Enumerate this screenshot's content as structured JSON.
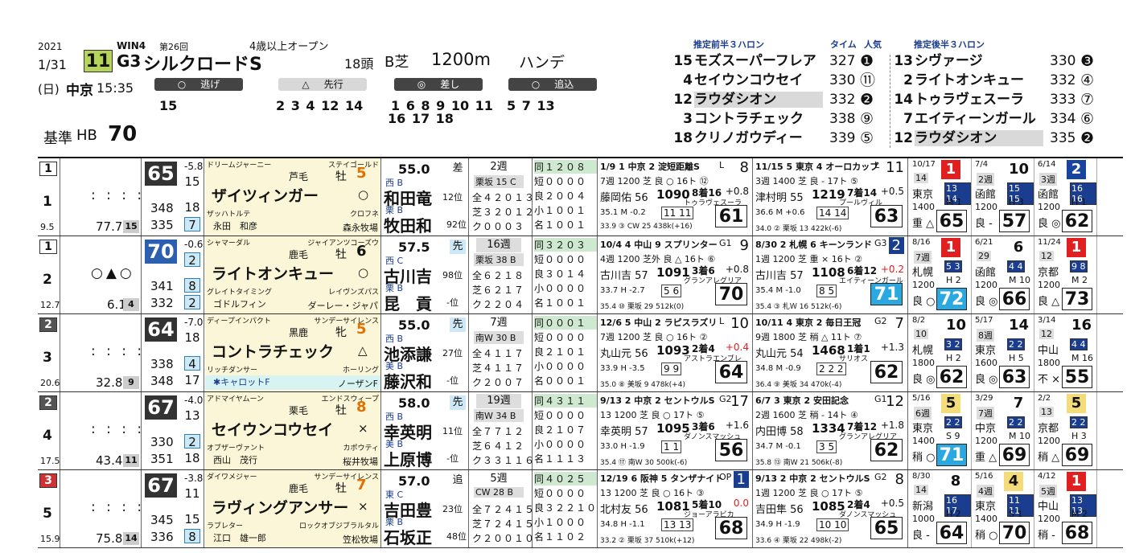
{
  "race": {
    "year": "2021",
    "date": "1/31",
    "day": "(日)",
    "venue": "中京",
    "time": "15:35",
    "win": "WIN4",
    "kai": "第26回",
    "race_no": "11",
    "grade": "G3",
    "name": "シルクロードS",
    "condition": "4歳以上オープン",
    "field": "18頭",
    "course": "B芝",
    "distance": "1200m",
    "handicap": "ハンデ",
    "baseline_label": "基準",
    "baseline_code": "HB",
    "baseline_value": "70"
  },
  "styles": {
    "nige": {
      "label": "逃げ",
      "horses": "15"
    },
    "senko": {
      "label": "先行",
      "horses": "2  3  4 12 14"
    },
    "sashi": {
      "label": "差し",
      "horses_line1": "1  6  8  9 10 11",
      "horses_line2": "16 17 18"
    },
    "oikomi": {
      "label": "追込",
      "horses": "5  7 13"
    }
  },
  "pace": {
    "front_title": "推定前半３ハロン",
    "back_title": "推定後半３ハロン",
    "time_label": "タイム",
    "pop_label": "人気",
    "front": [
      {
        "no": "15",
        "name": "モズスーパーフレア",
        "time": "327",
        "pop": "1",
        "hl": false
      },
      {
        "no": " 4",
        "name": "セイウンコウセイ",
        "time": "330",
        "pop": "11",
        "hl": false
      },
      {
        "no": "12",
        "name": "ラウダシオン",
        "time": "332",
        "pop": "2",
        "hl": true
      },
      {
        "no": " 3",
        "name": "コントラチェック",
        "time": "338",
        "pop": "9",
        "hl": false
      },
      {
        "no": "18",
        "name": "クリノガウディー",
        "time": "339",
        "pop": "5",
        "hl": false
      }
    ],
    "back": [
      {
        "no": "13",
        "name": "シヴァージ",
        "time": "330",
        "pop": "3",
        "hl": false
      },
      {
        "no": " 2",
        "name": "ライトオンキュー",
        "time": "332",
        "pop": "4",
        "hl": false
      },
      {
        "no": "14",
        "name": "トゥラヴェスーラ",
        "time": "333",
        "pop": "7",
        "hl": false
      },
      {
        "no": " 7",
        "name": "エイティーンガール",
        "time": "334",
        "pop": "6",
        "hl": false
      },
      {
        "no": "12",
        "name": "ラウダシオン",
        "time": "335",
        "pop": "2",
        "hl": true
      }
    ]
  },
  "horses": [
    {
      "waku": "1",
      "umaban": "1",
      "odds": "9.5",
      "marks": ": : : :",
      "ev": "77.7",
      "evrank": "15",
      "idx": "65",
      "idx_diff": "-5.8",
      "idx_rank": "15",
      "sub1": "348",
      "sub1r": "18",
      "sub2": "335",
      "sub2r": "7",
      "sire": "ドリームジャーニー",
      "bms": "ステイゴールド",
      "color": "芦毛",
      "sex": "牡",
      "age": "5",
      "name": "ザイツィンガー",
      "mark": "○",
      "dam": "ザッハトルテ",
      "damsire": "クロフネ",
      "owner": "永田　和彦",
      "breeder": "森永牧場",
      "weight": "55.0",
      "region": "西",
      "jockey": "和田竜",
      "jmark": "B",
      "trainer": "牧田和",
      "tmark": "栗",
      "jrank": "12位",
      "trank": "92位",
      "style": "差",
      "interval": "2週",
      "cond": "栗坂 15 C",
      "rec1": "全４２０１３",
      "rec2": "芝３２０１２",
      "rec3": "ク０００３",
      "dist1": "同１２０８",
      "dist2": "短００００",
      "dist3": "良２００４",
      "dist4": "小１００１",
      "dist5": "名１００１"
    },
    {
      "waku": "1",
      "umaban": "2",
      "odds": "12.7",
      "marks": "○▲○",
      "ev": "6.1",
      "evrank": "4",
      "idx": "70",
      "idx_diff": "-0.6",
      "idx_rank": "2",
      "sub1": "341",
      "sub1r": "8",
      "sub2": "332",
      "sub2r": "2",
      "sire": "シャマーダル",
      "bms": "ジャイアンツコーズウ",
      "color": "鹿毛",
      "sex": "牡",
      "age": "6",
      "name": "ライトオンキュー",
      "mark": "○",
      "dam": "グレイトタイミング",
      "damsire": "レイヴンズパス",
      "owner": "ゴドルフィン",
      "breeder": "ダーレー・ジャパ",
      "weight": "57.5",
      "region": "西",
      "jockey": "古川吉",
      "jmark": "C",
      "trainer": "昆　貢",
      "tmark": "栗",
      "jrank": "98位",
      "trank": "-位",
      "style": "先",
      "interval": "16週",
      "cond": "栗坂 38 B",
      "rec1": "全６２１８",
      "rec2": "芝６２１７",
      "rec3": "ク２２０４",
      "dist1": "同３２０３",
      "dist2": "短００００",
      "dist3": "良３０１４",
      "dist4": "小００００",
      "dist5": "名１００１"
    },
    {
      "waku": "2",
      "umaban": "3",
      "odds": "20.6",
      "marks": ": : : :",
      "ev": "32.8",
      "evrank": "9",
      "idx": "64",
      "idx_diff": "-7.0",
      "idx_rank": "18",
      "sub1": "338",
      "sub1r": "4",
      "sub2": "348",
      "sub2r": "17",
      "sire": "ディープインパクト",
      "bms": "サンデーサイレンス",
      "color": "黒鹿",
      "sex": "牝",
      "age": "5",
      "name": "コントラチェック",
      "mark": "△",
      "dam": "リッチダンサー",
      "damsire": "ホーリング",
      "owner": "✱キャロットF",
      "breeder": "ノーザンF",
      "weight": "55.0",
      "region": "西",
      "jockey": "池添謙",
      "jmark": "B",
      "trainer": "藤沢和",
      "tmark": "美",
      "jrank": "27位",
      "trank": "-位",
      "style": "先",
      "interval": "7週",
      "cond": "南W 30 B",
      "rec1": "全４１１７",
      "rec2": "芝４１１７",
      "rec3": "ク２００７",
      "dist1": "同０００１",
      "dist2": "短００００",
      "dist3": "良２１０１",
      "dist4": "小００００",
      "dist5": "名０００１"
    },
    {
      "waku": "2",
      "umaban": "4",
      "odds": "17.5",
      "marks": ": : : :",
      "ev": "43.4",
      "evrank": "11",
      "idx": "67",
      "idx_diff": "-4.0",
      "idx_rank": "13",
      "sub1": "330",
      "sub1r": "2",
      "sub2": "351",
      "sub2r": "18",
      "sire": "アドマイヤムーン",
      "bms": "エンドスウィープ",
      "color": "栗毛",
      "sex": "牡",
      "age": "8",
      "name": "セイウンコウセイ",
      "mark": "×",
      "dam": "オブザーヴァント",
      "damsire": "カポウティ",
      "owner": "西山　茂行",
      "breeder": "桜井牧場",
      "weight": "58.0",
      "region": "西",
      "jockey": "幸英明",
      "jmark": "B",
      "trainer": "上原博",
      "tmark": "美",
      "jrank": "11位",
      "trank": "-位",
      "style": "先",
      "interval": "19週",
      "cond": "南W 34 B",
      "rec1": "全７７１２",
      "rec2": "芝６４１２",
      "rec3": "ク３３１１６",
      "dist1": "同４３１１",
      "dist2": "短００００",
      "dist3": "良２１０７",
      "dist4": "小００００",
      "dist5": "名１１１３"
    },
    {
      "waku": "3",
      "umaban": "5",
      "odds": "15.9",
      "marks": ": : : :",
      "ev": "75.8",
      "evrank": "14",
      "idx": "67",
      "idx_diff": "-3.8",
      "idx_rank": "11",
      "sub1": "345",
      "sub1r": "15",
      "sub2": "336",
      "sub2r": "8",
      "sire": "ダイワメジャー",
      "bms": "サンデーサイレンス",
      "color": "鹿毛",
      "sex": "牡",
      "age": "7",
      "name": "ラヴィングアンサー",
      "mark": "×",
      "dam": "ラブレター",
      "damsire": "ロックオブジブラルタル",
      "owner": "江口　雄一郎",
      "breeder": "笠松牧場",
      "weight": "57.0",
      "region": "東",
      "jockey": "吉田豊",
      "jmark": "C",
      "trainer": "石坂正",
      "tmark": "栗",
      "jrank": "23位",
      "trank": "48位",
      "style": "追",
      "interval": "5週",
      "cond": "CW 28 B",
      "rec1": "全７２４１５",
      "rec2": "芝７２４１５",
      "rec3": "ク２００１０",
      "dist1": "同４０２５",
      "dist2": "短００００",
      "dist3": "良３２２１０",
      "dist4": "小１０００",
      "dist5": "名１１０２"
    }
  ],
  "races": [
    [
      {
        "date": "1/9",
        "grade": "1",
        "venue": "中京",
        "cls": "2 淀短距離S",
        "gl": "L",
        "pos": "8",
        "meta": "7週 1200 芝 良 ○ 16ト ⑫",
        "jockey": "藤岡佑",
        "wt": "56",
        "time": "1090",
        "margin": "8着16",
        "diff": "+0.8",
        "winner": "トゥラヴェスーラ",
        "score": "61",
        "c1": "11 11",
        "sub": "35.1 M -0.2",
        "tr": "33.9 ③ CW 25 438k(+16)"
      },
      {
        "date": "11/15",
        "grade": "5",
        "venue": "東京",
        "cls": "4 オーロカップ",
        "gl": "L",
        "pos": "11",
        "meta": "3週 1400 芝 良 - 17ト ⑤",
        "jockey": "津村明",
        "wt": "55",
        "time": "1219",
        "margin": "7着14",
        "diff": "+0.5",
        "winner": "プールヴィル",
        "score": "63",
        "c1": "14 14",
        "sub": "36.6 M +0.6",
        "tr": "34.0 ② 栗坂 13 422k(-6)"
      }
    ],
    [
      {
        "date": "10/4",
        "grade": "4",
        "venue": "中山",
        "cls": "9 スプリンター",
        "gl": "G1",
        "pos": "9",
        "meta": "4週 1200 芝外 良 △ 16ト ⑥",
        "jockey": "古川吉",
        "wt": "57",
        "time": "1091",
        "margin": "3着6",
        "diff": "+0.8",
        "winner": "グランアレグリア",
        "score": "70",
        "c1": "5 6",
        "sub": "33.7 H -2.7",
        "tr": "35.4 ⑩ 栗坂 29 512k(0)"
      },
      {
        "date": "8/30",
        "grade": "2",
        "venue": "札幌",
        "cls": "6 キーンランド",
        "gl": "G3",
        "pos": "2",
        "meta": "1週 1200 芝 重 × 16ト ②",
        "jockey": "古川吉",
        "wt": "57",
        "time": "1108",
        "margin": "6着12",
        "diff": "+0.2",
        "winner": "エイティーンガール",
        "score": "71",
        "c1": "8 5",
        "sub": "35.4 M -1.0",
        "tr": "35.4 ③ 札Ｗ 16 512k(-6)"
      }
    ],
    [
      {
        "date": "12/6",
        "grade": "5",
        "venue": "中山",
        "cls": "2 ラピスラズリ",
        "gl": "L",
        "pos": "10",
        "meta": "7週 1200 芝 良 ○ 16ト ②",
        "jockey": "丸山元",
        "wt": "56",
        "time": "1093",
        "margin": "2着4",
        "diff": "+0.4",
        "winner": "アストラエンブレ",
        "score": "64",
        "c1": "9 9",
        "sub": "33.9 H -3.5",
        "tr": "35.0 ⑧ 美坂 9 478k(+4)"
      },
      {
        "date": "10/11",
        "grade": "4",
        "venue": "東京",
        "cls": "2 毎日王冠",
        "gl": "G2",
        "pos": "7",
        "meta": "9週 1800 芝 稍 △ 11ト ⑦",
        "jockey": "丸山元",
        "wt": "54",
        "time": "1468",
        "margin": "1着1",
        "diff": "+1.3",
        "winner": "サリオス",
        "score": "62",
        "c1": "2 2 2",
        "sub": "34.8 M -0.9",
        "tr": "36.4 ⑨ 美坂 34 470k(-4)"
      }
    ],
    [
      {
        "date": "9/13",
        "grade": "2",
        "venue": "中京",
        "cls": "2 セントウルS",
        "gl": "G2",
        "pos": "17",
        "meta": "13 1200 芝 良 ○ 17ト ⑤",
        "jockey": "幸英明",
        "wt": "57",
        "time": "1095",
        "margin": "3着6",
        "diff": "+1.6",
        "winner": "ダノンスマッシュ",
        "score": "56",
        "c1": "1 1",
        "sub": "33.0 H -1.9",
        "tr": "35.4 ⑰ 南W 30 500k(-6)"
      },
      {
        "date": "6/7",
        "grade": "3",
        "venue": "東京",
        "cls": "2 安田記念",
        "gl": "G1",
        "pos": "12",
        "meta": "2週 1600 芝 稍 - 14ト ④",
        "jockey": "内田博",
        "wt": "58",
        "time": "1334",
        "margin": "7着12",
        "diff": "+1.8",
        "winner": "グランアレグリア",
        "score": "62",
        "c1": "3 5",
        "sub": "34.7 M -0.1",
        "tr": "35.8 ⑬ 南W 21 506k(-8)"
      }
    ],
    [
      {
        "date": "12/19",
        "grade": "6",
        "venue": "阪神",
        "cls": "5 タンザナイト",
        "gl": "OP",
        "pos": "1",
        "meta": "13 1200 芝 良 ○ 16ト ③",
        "jockey": "北村友",
        "wt": "56",
        "time": "1081",
        "margin": "5着10",
        "diff": "0.0",
        "winner": "ジョーアラビカ",
        "score": "68",
        "c1": "13 13",
        "sub": "34.8 H -1.1",
        "tr": "33.2 ② 栗坂 37 510k(+12)"
      },
      {
        "date": "9/13",
        "grade": "2",
        "venue": "中京",
        "cls": "2 セントウルS",
        "gl": "G2",
        "pos": "8",
        "meta": "1週 1200 芝 良 ○ 17ト ⑤",
        "jockey": "吉田隼",
        "wt": "56",
        "time": "1085",
        "margin": "2着4",
        "diff": "+0.5",
        "winner": "ダノンスマッシュ",
        "score": "65",
        "c1": "10 10",
        "sub": "34.9 H -1.9",
        "tr": "33.6 ④ 栗坂 22 498k(-2)"
      }
    ]
  ],
  "mini": [
    [
      {
        "date": "10/17",
        "place": "1",
        "color": "red",
        "sub": "14",
        "venue": "東京",
        "dist": "1400",
        "gg": "重",
        "mark": "△",
        "score": "65",
        "boxes": "13 14",
        "hm": "M",
        "hmn": "1"
      },
      {
        "date": "7/4",
        "place": "10",
        "color": "none",
        "sub": "2週",
        "venue": "函館",
        "dist": "1200",
        "gg": "良",
        "mark": "-",
        "score": "57",
        "boxes": "15 15",
        "hm": "H",
        "hmn": "3"
      },
      {
        "date": "6/14",
        "place": "2",
        "color": "blue",
        "sub": "3週",
        "venue": "函館",
        "dist": "1200",
        "gg": "良",
        "mark": "◎",
        "score": "62",
        "boxes": "16 16",
        "hm": "H",
        "hmn": "1"
      }
    ],
    [
      {
        "date": "8/16",
        "place": "1",
        "color": "red",
        "sub": "7週",
        "venue": "札幌",
        "dist": "1200",
        "gg": "良",
        "mark": "○",
        "score": "72",
        "boxes": "5 3",
        "hm": "H",
        "hmn": "2"
      },
      {
        "date": "6/21",
        "place": "6",
        "color": "none",
        "sub": "29",
        "venue": "函館",
        "dist": "1200",
        "gg": "良",
        "mark": "◎",
        "score": "66",
        "boxes": "4 4",
        "hm": "M",
        "hmn": "10"
      },
      {
        "date": "11/24",
        "place": "1",
        "color": "red",
        "sub": "12",
        "venue": "京都",
        "dist": "1200",
        "gg": "良",
        "mark": "△",
        "score": "73",
        "boxes": "9 8",
        "hm": "M",
        "hmn": "2"
      }
    ],
    [
      {
        "date": "8/2",
        "place": "10",
        "color": "none",
        "sub": "10",
        "venue": "札幌",
        "dist": "1800",
        "gg": "良",
        "mark": "◎",
        "score": "62",
        "boxes": "3 2",
        "hm": "H",
        "hmn": "2"
      },
      {
        "date": "5/17",
        "place": "14",
        "color": "none",
        "sub": "8週",
        "venue": "東京",
        "dist": "1600",
        "gg": "良",
        "mark": "◎",
        "score": "63",
        "boxes": "2 2",
        "hm": "H",
        "hmn": "5"
      },
      {
        "date": "3/14",
        "place": "16",
        "color": "none",
        "sub": "12",
        "venue": "中山",
        "dist": "1800",
        "gg": "不",
        "mark": "×",
        "score": "55",
        "boxes": "4 4",
        "hm": "M",
        "hmn": "16"
      }
    ],
    [
      {
        "date": "5/16",
        "place": "5",
        "color": "yellow",
        "sub": "6週",
        "venue": "東京",
        "dist": "1400",
        "gg": "稍",
        "mark": "○",
        "score": "71",
        "boxes": "2 2",
        "hm": "S",
        "hmn": "9"
      },
      {
        "date": "3/29",
        "place": "7",
        "color": "none",
        "sub": "7週",
        "venue": "中京",
        "dist": "1200",
        "gg": "重",
        "mark": "△",
        "score": "69",
        "boxes": "2 2",
        "hm": "M",
        "hmn": "10"
      },
      {
        "date": "2/2",
        "place": "5",
        "color": "yellow",
        "sub": "13",
        "venue": "京都",
        "dist": "1200",
        "gg": "稍",
        "mark": "△",
        "score": "69",
        "boxes": "2 2",
        "hm": "H",
        "hmn": "3"
      }
    ],
    [
      {
        "date": "8/30",
        "place": "8",
        "color": "none",
        "sub": "14",
        "venue": "新潟",
        "dist": "1000",
        "gg": "良",
        "mark": "-",
        "score": "64",
        "boxes": "16 17",
        "hm": "H",
        "hmn": "2"
      },
      {
        "date": "5/16",
        "place": "4",
        "color": "yellow",
        "sub": "4週",
        "venue": "東京",
        "dist": "1400",
        "gg": "稍",
        "mark": "○",
        "score": "70",
        "boxes": "11 11",
        "hm": "S",
        "hmn": "1"
      },
      {
        "date": "4/12",
        "place": "1",
        "color": "red",
        "sub": "5週",
        "venue": "中山",
        "dist": "1200",
        "gg": "稍",
        "mark": "-",
        "score": "68",
        "boxes": "13 13",
        "hm": "M",
        "hmn": "2"
      }
    ]
  ]
}
